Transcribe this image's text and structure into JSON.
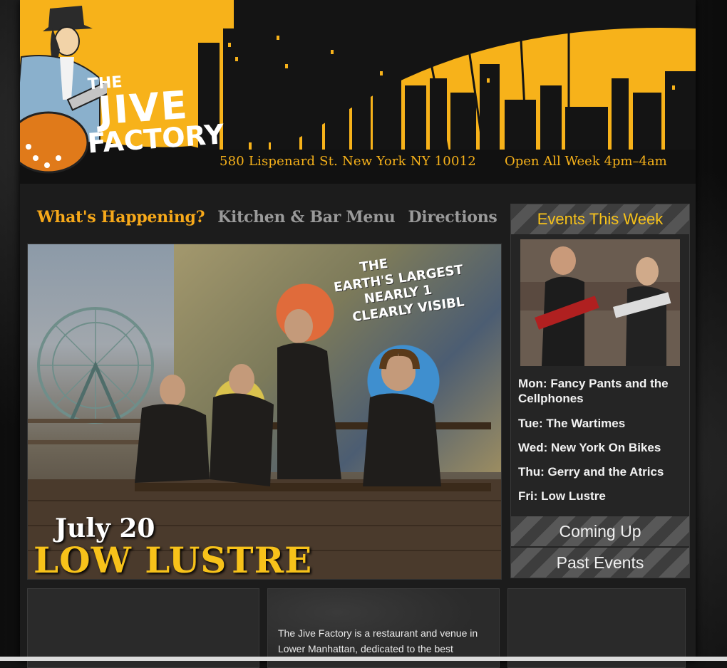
{
  "header": {
    "logo": {
      "line1": "THE",
      "line2": "JIVE",
      "line3": "FACTORY"
    },
    "address": "580 Lispenard St. New York NY 10012",
    "hours": "Open All Week 4pm–4am"
  },
  "nav": {
    "items": [
      {
        "label": "What's Happening?",
        "active": true
      },
      {
        "label": "Kitchen & Bar Menu",
        "active": false
      },
      {
        "label": "Directions",
        "active": false
      }
    ]
  },
  "hero": {
    "mural_text": [
      "THE",
      "EARTH'S LARGEST",
      "NEARLY 1",
      "CLEARLY VISIBL"
    ],
    "date": "July 20",
    "band": "LOW LUSTRE"
  },
  "sidebar": {
    "title": "Events This Week",
    "events": [
      "Mon: Fancy Pants and the Cellphones",
      "Tue: The Wartimes",
      "Wed: New York On Bikes",
      "Thu: Gerry and the Atrics",
      "Fri: Low Lustre"
    ],
    "coming_up": "Coming Up",
    "past_events": "Past Events"
  },
  "about": {
    "text": "The Jive Factory is a restaurant and venue in Lower Manhattan, dedicated to the best"
  },
  "colors": {
    "accent": "#f7b21a",
    "nav_inactive": "#9a9a9a",
    "background": "#1c1c1c"
  }
}
